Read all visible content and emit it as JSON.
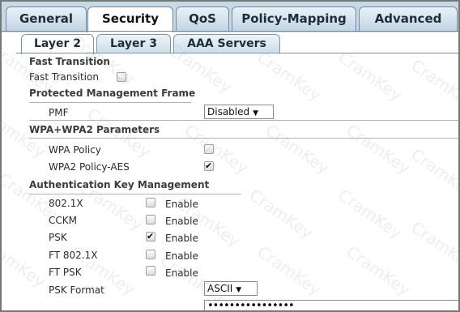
{
  "top_tabs": [
    {
      "label": "General",
      "active": false
    },
    {
      "label": "Security",
      "active": true
    },
    {
      "label": "QoS",
      "active": false
    },
    {
      "label": "Policy-Mapping",
      "active": false
    },
    {
      "label": "Advanced",
      "active": false
    }
  ],
  "sub_tabs": [
    {
      "label": "Layer 2",
      "active": true
    },
    {
      "label": "Layer 3",
      "active": false
    },
    {
      "label": "AAA Servers",
      "active": false
    }
  ],
  "fast_transition": {
    "heading": "Fast Transition",
    "label": "Fast Transition",
    "checked": false
  },
  "pmf": {
    "heading": "Protected Management Frame",
    "label": "PMF",
    "value": "Disabled"
  },
  "wpa": {
    "heading": "WPA+WPA2 Parameters",
    "wpa_policy_label": "WPA Policy",
    "wpa_policy_checked": false,
    "wpa2_aes_label": "WPA2 Policy-AES",
    "wpa2_aes_checked": true
  },
  "akm": {
    "heading": "Authentication Key Management",
    "enable_label": "Enable",
    "items": [
      {
        "label": "802.1X",
        "checked": false
      },
      {
        "label": "CCKM",
        "checked": false
      },
      {
        "label": "PSK",
        "checked": true
      },
      {
        "label": "FT 802.1X",
        "checked": false
      },
      {
        "label": "FT PSK",
        "checked": false
      }
    ],
    "psk_format_label": "PSK Format",
    "psk_format_value": "ASCII",
    "psk_value": "••••••••••••••••"
  },
  "watermark_text": "CramKey"
}
